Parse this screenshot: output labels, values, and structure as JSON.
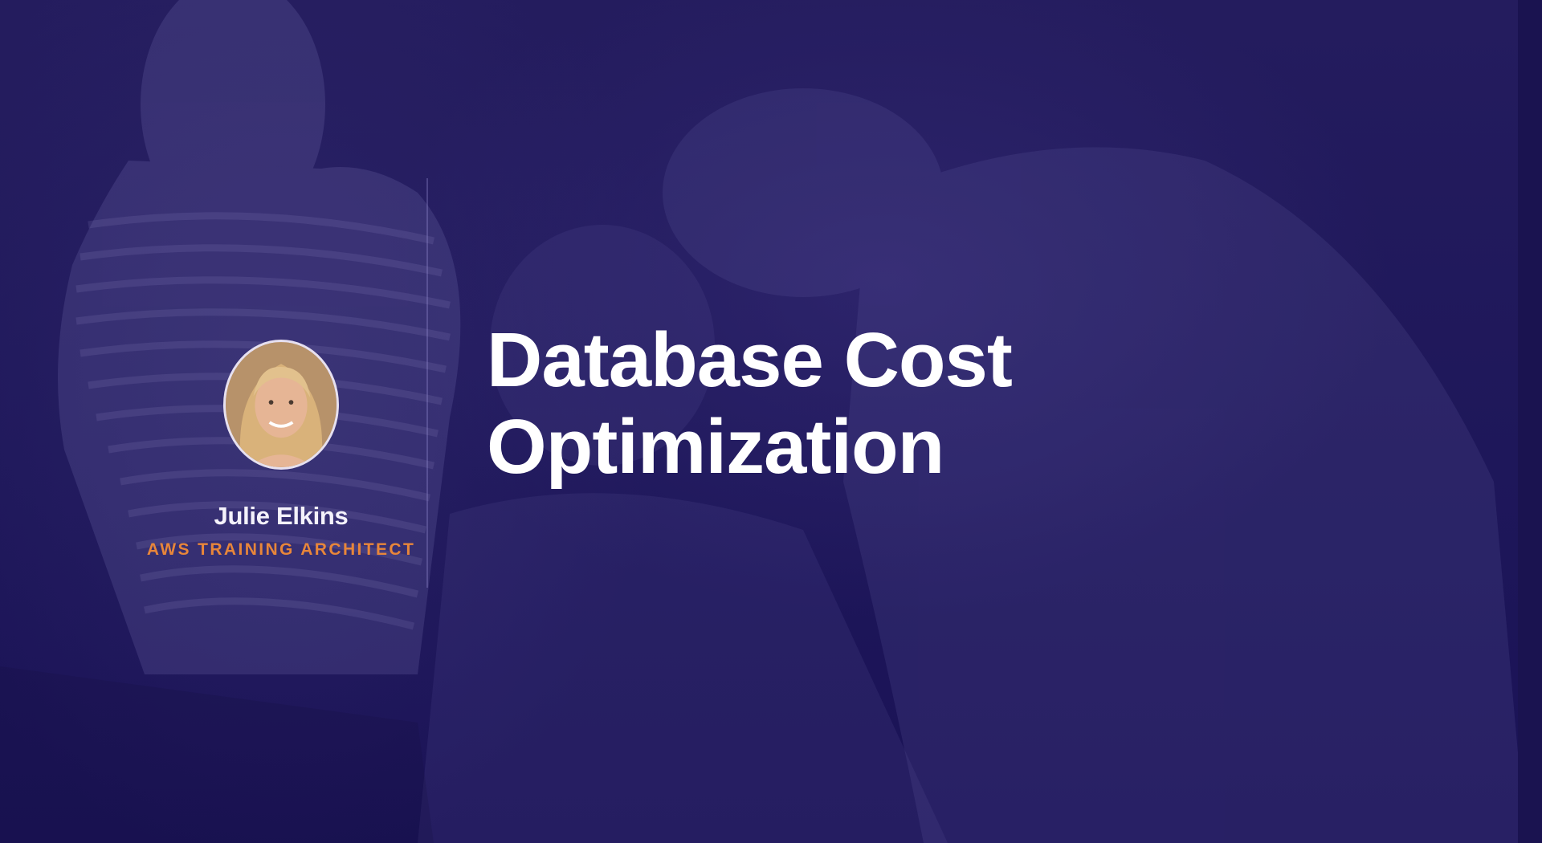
{
  "slide": {
    "title_line1": "Database Cost",
    "title_line2": "Optimization"
  },
  "presenter": {
    "name": "Julie Elkins",
    "role": "AWS TRAINING ARCHITECT"
  },
  "colors": {
    "background": "#1e175a",
    "title": "#ffffff",
    "name": "#f4f2fb",
    "role_accent": "#e8863a"
  }
}
